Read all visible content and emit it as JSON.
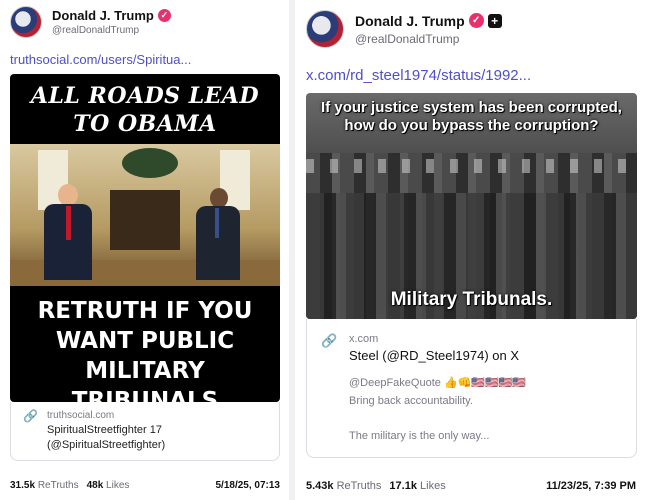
{
  "left": {
    "name": "Donald J. Trump",
    "handle": "@realDonaldTrump",
    "link": "truthsocial.com/users/Spiritua...",
    "image_top_text": "ALL ROADS LEAD TO OBAMA",
    "image_bottom_text": "RETRUTH IF YOU WANT PUBLIC MILITARY TRIBUNALS",
    "card": {
      "domain": "truthsocial.com",
      "title_line1": "SpiritualStreetfighter 17",
      "title_line2": "(@SpiritualStreetfighter)"
    },
    "stats": {
      "retruths_count": "31.5k",
      "retruths_label": "ReTruths",
      "likes_count": "48k",
      "likes_label": "Likes",
      "date": "5/18/25, 07:13"
    }
  },
  "right": {
    "name": "Donald J. Trump",
    "handle": "@realDonaldTrump",
    "link": "x.com/rd_steel1974/status/1992...",
    "image_top_text": "If your justice system has been corrupted, how do you bypass the corruption?",
    "image_bottom_text": "Military Tribunals.",
    "card": {
      "domain": "x.com",
      "title": "Steel (@RD_Steel1974) on X",
      "line1": "@DeepFakeQuote 👍👊🇺🇸🇺🇸🇺🇸🇺🇸",
      "line2": "Bring back accountability.",
      "line3": "The military is the only way..."
    },
    "stats": {
      "retruths_count": "5.43k",
      "retruths_label": "ReTruths",
      "likes_count": "17.1k",
      "likes_label": "Likes",
      "date": "11/23/25, 7:39 PM"
    }
  },
  "icons": {
    "verified": "verified-badge-icon",
    "plus": "plus-icon",
    "link": "link-chain-icon"
  },
  "colors": {
    "link": "#4f4fc8",
    "verified": "#e8316c"
  }
}
